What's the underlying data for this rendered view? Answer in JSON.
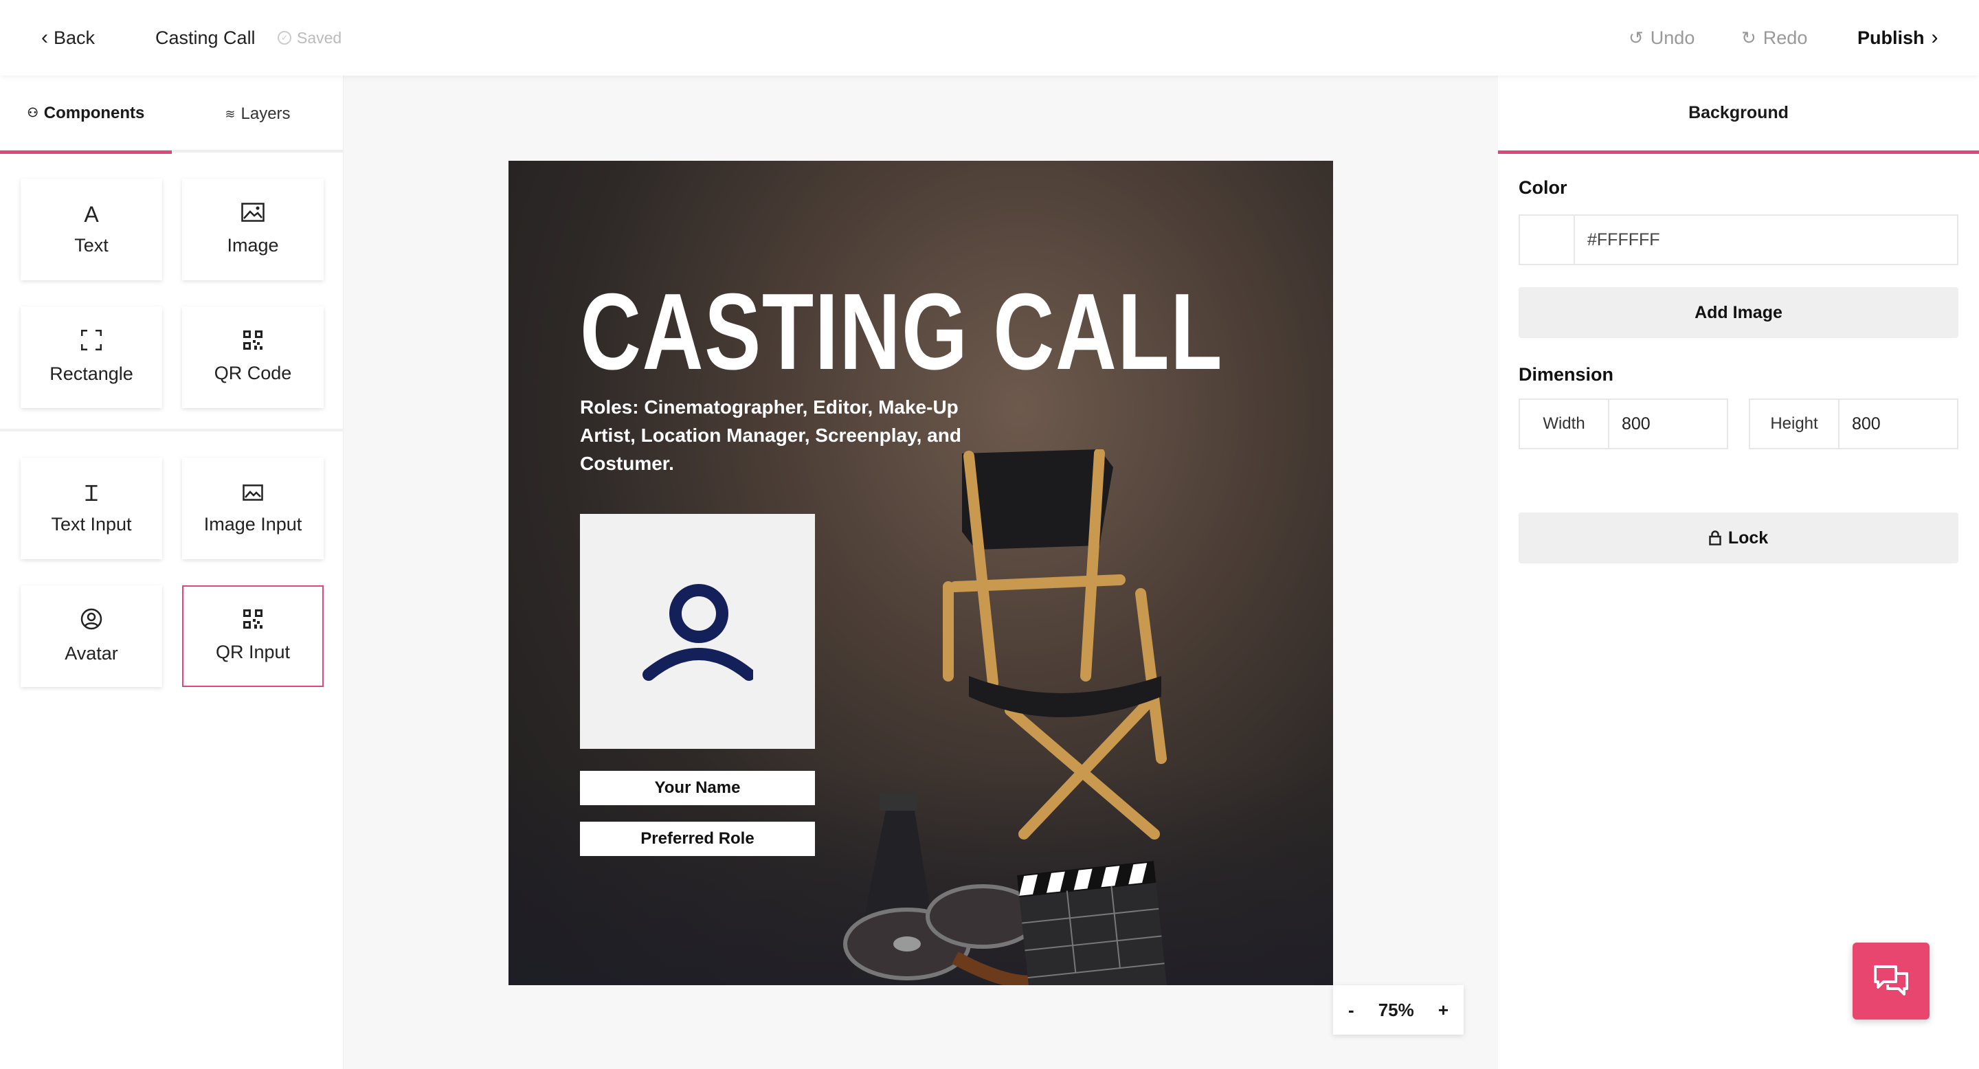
{
  "topbar": {
    "back_label": "Back",
    "document_title": "Casting Call",
    "save_status": "Saved",
    "undo_label": "Undo",
    "redo_label": "Redo",
    "publish_label": "Publish"
  },
  "left_panel": {
    "tabs": [
      {
        "label": "Components",
        "icon": "components-icon",
        "active": true
      },
      {
        "label": "Layers",
        "icon": "layers-icon",
        "active": false
      }
    ],
    "components": [
      {
        "label": "Text",
        "icon": "text-icon",
        "glyph": "A"
      },
      {
        "label": "Image",
        "icon": "image-icon",
        "glyph": "🖼"
      },
      {
        "label": "Rectangle",
        "icon": "rectangle-icon",
        "glyph": "⛶"
      },
      {
        "label": "QR Code",
        "icon": "qr-code-icon",
        "glyph": "▦"
      }
    ],
    "inputs": [
      {
        "label": "Text Input",
        "icon": "text-cursor-icon",
        "glyph": "Ɪ"
      },
      {
        "label": "Image Input",
        "icon": "image-input-icon",
        "glyph": "🖼"
      },
      {
        "label": "Avatar",
        "icon": "avatar-icon",
        "glyph": "☺"
      },
      {
        "label": "QR Input",
        "icon": "qr-input-icon",
        "glyph": "▦",
        "selected": true
      }
    ]
  },
  "canvas": {
    "poster": {
      "title": "CASTING CALL",
      "roles": "Roles: Cinematographer, Editor, Make-Up Artist, Location Manager, Screenplay, and Costumer.",
      "name_field": "Your Name",
      "role_field": "Preferred Role"
    },
    "zoom": {
      "minus": "-",
      "level": "75%",
      "plus": "+"
    }
  },
  "right_panel": {
    "tab_label": "Background",
    "color_label": "Color",
    "color_value": "#FFFFFF",
    "add_image_label": "Add Image",
    "dimension_label": "Dimension",
    "width_label": "Width",
    "width_value": "800",
    "height_label": "Height",
    "height_value": "800",
    "lock_label": "Lock"
  },
  "colors": {
    "accent": "#e0457b",
    "chat_button": "#e8466f",
    "avatar_stroke": "#14205a"
  }
}
